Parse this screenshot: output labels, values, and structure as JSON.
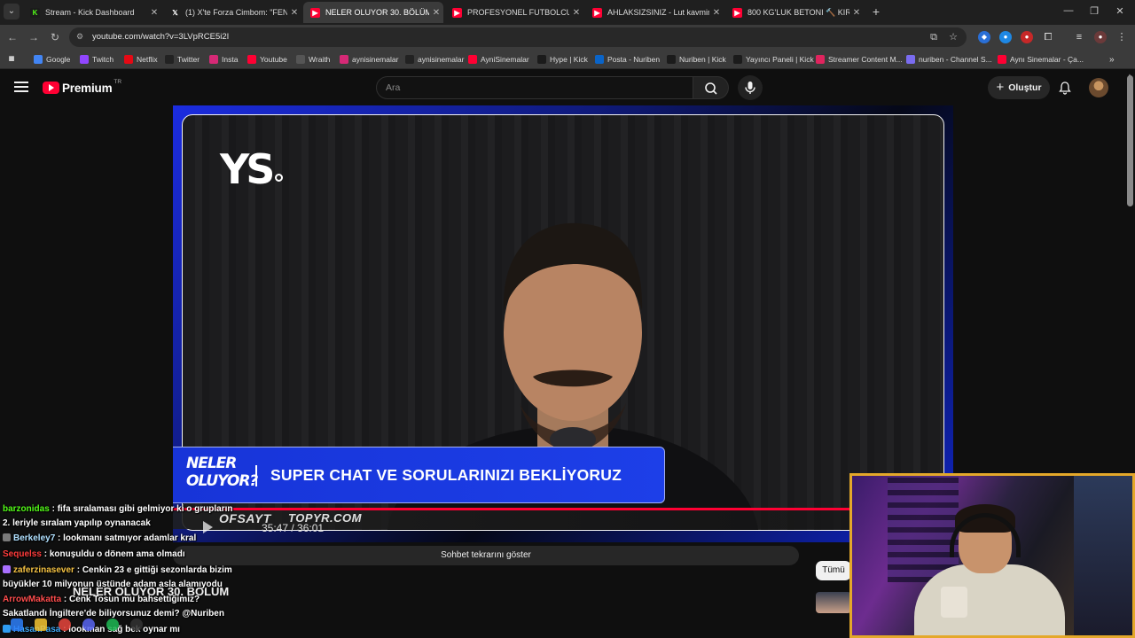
{
  "browser": {
    "tabs": [
      {
        "title": "Stream - Kick Dashboard",
        "favicon": "kick-icon",
        "active": false
      },
      {
        "title": "(1) X'te Forza Cimbom: \"FENERBA",
        "favicon": "x-icon",
        "active": false
      },
      {
        "title": "NELER OLUYOR 30. BÖLÜM - YouTube",
        "favicon": "youtube-icon",
        "active": true
      },
      {
        "title": "PROFESYONEL FUTBOLCU SENİ",
        "favicon": "youtube-icon",
        "active": false
      },
      {
        "title": "AHLAKSIZSINIZ - Lut kavminden",
        "favicon": "youtube-icon",
        "active": false
      },
      {
        "title": "800 KG'LUK BETONI 🔨 KIRAR",
        "favicon": "youtube-icon",
        "active": false
      }
    ],
    "new_tab": "+",
    "window_controls": {
      "minimize": "—",
      "maximize": "❐",
      "close": "✕"
    },
    "url": "youtube.com/watch?v=3LVpRCE5i2I",
    "bookmarks": [
      {
        "label": "Google",
        "icon": "google-icon",
        "color": "#4285f4"
      },
      {
        "label": "Twitch",
        "icon": "twitch-icon",
        "color": "#9146ff"
      },
      {
        "label": "Netflix",
        "icon": "netflix-icon",
        "color": "#e50914"
      },
      {
        "label": "Twitter",
        "icon": "x-icon",
        "color": "#222222"
      },
      {
        "label": "Insta",
        "icon": "instagram-icon",
        "color": "#d62976"
      },
      {
        "label": "Youtube",
        "icon": "youtube-icon",
        "color": "#ff0033"
      },
      {
        "label": "Wraith",
        "icon": "wraith-icon",
        "color": "#555555"
      },
      {
        "label": "aynisinemalar",
        "icon": "instagram-icon",
        "color": "#d62976"
      },
      {
        "label": "aynisinemalar",
        "icon": "x-icon",
        "color": "#222222"
      },
      {
        "label": "AyniSinemalar",
        "icon": "youtube-icon",
        "color": "#ff0033"
      },
      {
        "label": "Hype | Kick",
        "icon": "kick-icon",
        "color": "#1b1b1b"
      },
      {
        "label": "Posta - Nuriben",
        "icon": "outlook-icon",
        "color": "#0a64c8"
      },
      {
        "label": "Nuriben | Kick",
        "icon": "kick-icon",
        "color": "#1b1b1b"
      },
      {
        "label": "Yayıncı Paneli | Kick",
        "icon": "kick-icon",
        "color": "#1b1b1b"
      },
      {
        "label": "Streamer Content M...",
        "icon": "streamer-icon",
        "color": "#e0245e"
      },
      {
        "label": "nuriben - Channel S...",
        "icon": "channel-icon",
        "color": "#7a6cf0"
      },
      {
        "label": "Aynı Sinemalar - Ça...",
        "icon": "youtube-icon",
        "color": "#ff0033"
      }
    ]
  },
  "youtube": {
    "logo_text": "Premium",
    "country_code": "TR",
    "search_placeholder": "Ara",
    "create_label": "Oluştur",
    "chat_replay_label": "Sohbet tekrarını göster",
    "filter_chip": "Tümü",
    "video_title": "NELER OLUYOR 30. BÖLÜM"
  },
  "video": {
    "channel_logo": "YS",
    "lower_third_show": "NELER OLUYOR?",
    "lower_third_text": "SUPER CHAT VE SORULARINIZI BEKLİYORUZ",
    "sponsors": [
      "OFSAYT",
      "TOPYR.COM"
    ],
    "time": "35:47 / 36:01",
    "progress": 0.994,
    "accent": "#1d3fe8",
    "progress_color": "#ff0033"
  },
  "chat": {
    "messages": [
      {
        "user": "barzonidas",
        "user_color": "#53fc18",
        "text": "fifa sıralaması gibi gelmiyor ki o grupların"
      },
      {
        "user": "",
        "user_color": "#ffffff",
        "text": "2. leriyle sıralam yapılıp oynanacak"
      },
      {
        "user": "Berkeley7",
        "user_color": "#b0e0ff",
        "text": "lookmanı satmıyor adamlar kral",
        "badge": "#7a7a7a"
      },
      {
        "user": "Sequelss",
        "user_color": "#ff3c3c",
        "text": "konuşuldu o dönem ama olmadı"
      },
      {
        "user": "zaferzinasever",
        "user_color": "#f5c243",
        "text": "Cenkin 23 e gittiği sezonlarda bizim",
        "badge": "#a970ff"
      },
      {
        "user": "",
        "user_color": "#ffffff",
        "text": "büyükler 10 milyonun üstünde adam asla alamıyodu"
      },
      {
        "user": "ArrowMakatta",
        "user_color": "#ff4d4d",
        "text": "Cenk Tosun mu bahsettiğimiz?"
      },
      {
        "user": "",
        "user_color": "#ffffff",
        "text": "Sakatlandı İngiltere'de biliyorsunuz demi? @Nuriben"
      },
      {
        "user": "HasanPasa",
        "user_color": "#3fa9f5",
        "text": "lookman sağ bek oynar mı",
        "badge": "#2e9cf0"
      }
    ]
  },
  "taskbar": [
    "windows-icon",
    "files-icon",
    "chrome-icon",
    "discord-icon",
    "spotify-icon",
    "obs-icon"
  ]
}
